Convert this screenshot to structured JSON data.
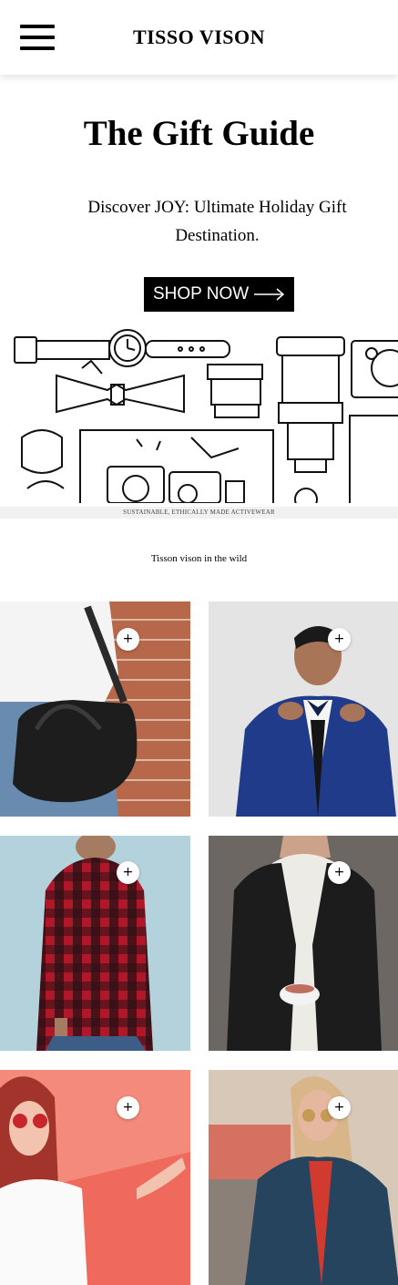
{
  "header": {
    "brand": "TISSO VISON",
    "menu_icon": "hamburger-menu-icon"
  },
  "hero": {
    "title": "The Gift Guide",
    "subtitle": "Discover JOY: Ultimate Holiday Gift Destination.",
    "button_label": "SHOP NOW",
    "button_icon": "arrow-right-icon"
  },
  "banner": {
    "tagline": "SUSTAINABLE, ETHICALLY MADE ACTIVEWEAR"
  },
  "gallery": {
    "heading": "Tisson vison in the wild",
    "add_label": "+",
    "items": [
      {
        "name": "leather-bag-photo"
      },
      {
        "name": "blue-tuxedo-photo"
      },
      {
        "name": "red-flannel-photo"
      },
      {
        "name": "leather-jacket-photo"
      },
      {
        "name": "red-sunglasses-photo"
      },
      {
        "name": "denim-jacket-photo"
      }
    ]
  },
  "colors": {
    "background": "#ffffff",
    "button": "#000000",
    "button_text": "#ffffff",
    "banner_bar": "#f1f1f1"
  }
}
